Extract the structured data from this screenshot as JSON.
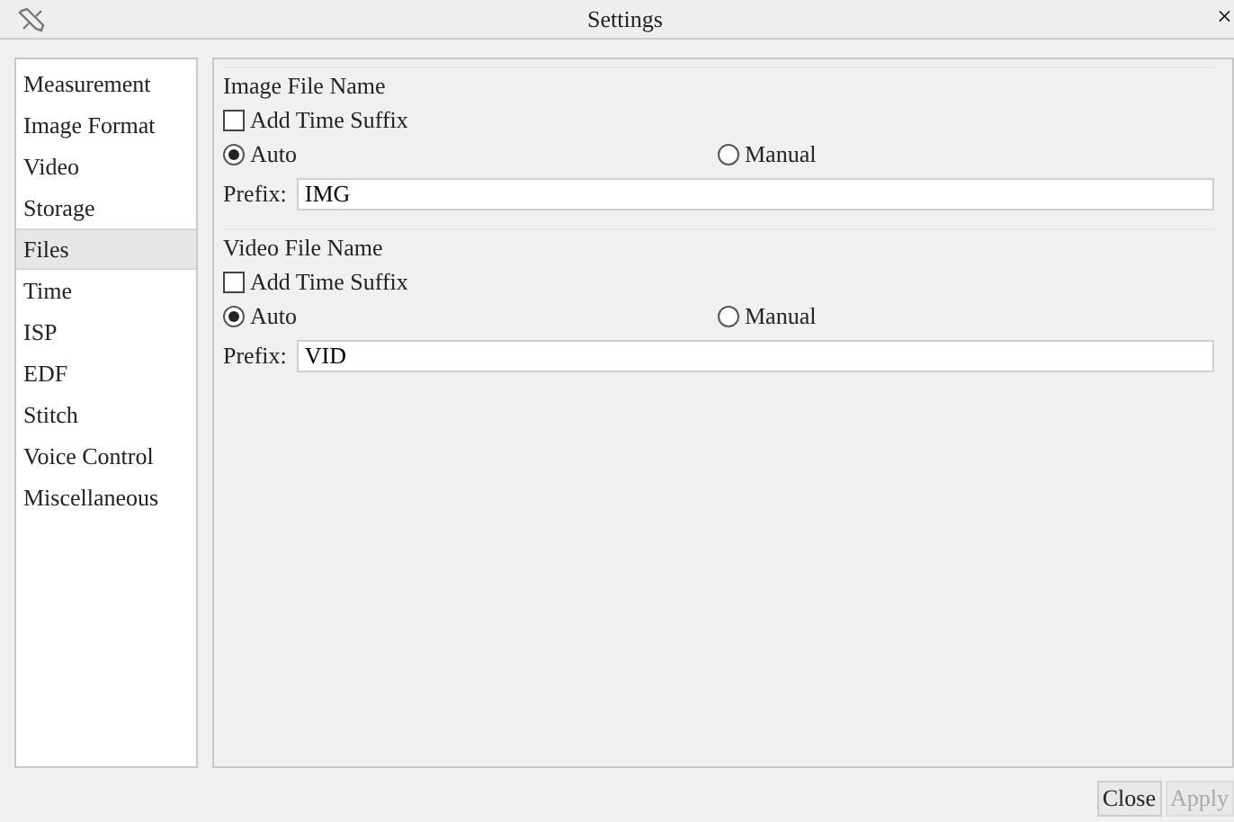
{
  "window": {
    "title": "Settings",
    "close": "×"
  },
  "sidebar": {
    "items": [
      {
        "label": "Measurement",
        "selected": false
      },
      {
        "label": "Image Format",
        "selected": false
      },
      {
        "label": "Video",
        "selected": false
      },
      {
        "label": "Storage",
        "selected": false
      },
      {
        "label": "Files",
        "selected": true
      },
      {
        "label": "Time",
        "selected": false
      },
      {
        "label": "ISP",
        "selected": false
      },
      {
        "label": "EDF",
        "selected": false
      },
      {
        "label": "Stitch",
        "selected": false
      },
      {
        "label": "Voice Control",
        "selected": false
      },
      {
        "label": "Miscellaneous",
        "selected": false
      }
    ]
  },
  "groups": [
    {
      "title": "Image File Name",
      "suffix": {
        "label": "Add Time Suffix",
        "checked": false
      },
      "modes": [
        {
          "label": "Auto",
          "selected": true
        },
        {
          "label": "Manual",
          "selected": false
        }
      ],
      "prefix_label": "Prefix:",
      "prefix": "IMG"
    },
    {
      "title": "Video File Name",
      "suffix": {
        "label": "Add Time Suffix",
        "checked": false
      },
      "modes": [
        {
          "label": "Auto",
          "selected": true
        },
        {
          "label": "Manual",
          "selected": false
        }
      ],
      "prefix_label": "Prefix:",
      "prefix": "VID"
    }
  ],
  "buttons": [
    {
      "label": "Close",
      "disabled": false
    },
    {
      "label": "Apply",
      "disabled": true
    }
  ]
}
